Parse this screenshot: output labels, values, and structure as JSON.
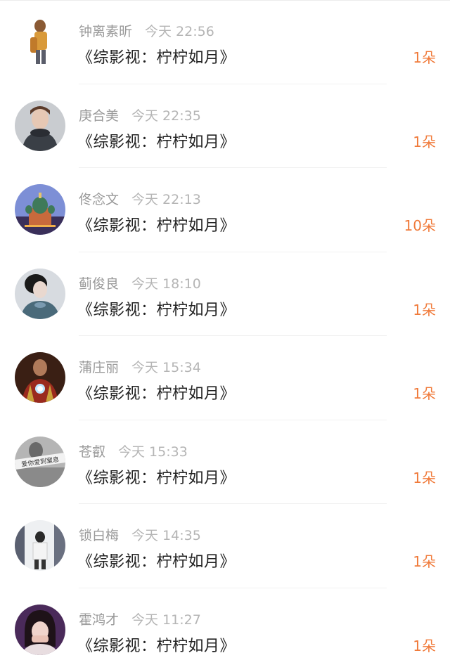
{
  "gifts": [
    {
      "user": "钟离素昕",
      "time": "今天 22:56",
      "book": "《综影视：柠柠如月》",
      "count": "1朵"
    },
    {
      "user": "庚合美",
      "time": "今天 22:35",
      "book": "《综影视：柠柠如月》",
      "count": "1朵"
    },
    {
      "user": "佟念文",
      "time": "今天 22:13",
      "book": "《综影视：柠柠如月》",
      "count": "10朵"
    },
    {
      "user": "蓟俊良",
      "time": "今天 18:10",
      "book": "《综影视：柠柠如月》",
      "count": "1朵"
    },
    {
      "user": "蒲庄丽",
      "time": "今天 15:34",
      "book": "《综影视：柠柠如月》",
      "count": "1朵"
    },
    {
      "user": "苍叡",
      "time": "今天 15:33",
      "book": "《综影视：柠柠如月》",
      "count": "1朵"
    },
    {
      "user": "锁白梅",
      "time": "今天 14:35",
      "book": "《综影视：柠柠如月》",
      "count": "1朵"
    },
    {
      "user": "霍鸿才",
      "time": "今天 11:27",
      "book": "《综影视：柠柠如月》",
      "count": "1朵"
    }
  ],
  "avatar_text": "爱你爱到窒息",
  "colors": {
    "accent": "#f07a3a",
    "username": "#9a9a9a",
    "time": "#b5b5b5",
    "title": "#222222"
  }
}
